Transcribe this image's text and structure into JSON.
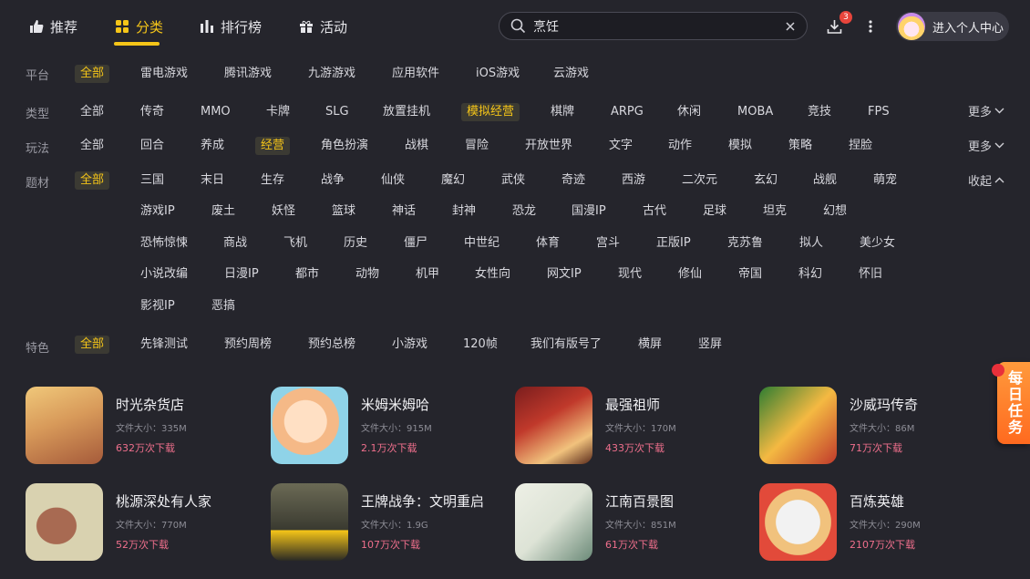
{
  "nav": {
    "tabs": [
      {
        "label": "推荐",
        "icon": "thumbs-up-icon"
      },
      {
        "label": "分类",
        "icon": "grid-icon"
      },
      {
        "label": "排行榜",
        "icon": "bar-chart-icon"
      },
      {
        "label": "活动",
        "icon": "gift-icon"
      }
    ],
    "active_index": 1,
    "accent": "#f5c518"
  },
  "search": {
    "value": "烹饪",
    "placeholder": ""
  },
  "downloads": {
    "badge": "3"
  },
  "profile": {
    "label": "进入个人中心"
  },
  "filters": {
    "platform": {
      "label": "平台",
      "options": [
        "全部",
        "雷电游戏",
        "腾讯游戏",
        "九游游戏",
        "应用软件",
        "iOS游戏",
        "云游戏"
      ],
      "selected": "全部"
    },
    "type": {
      "label": "类型",
      "options": [
        "全部",
        "传奇",
        "MMO",
        "卡牌",
        "SLG",
        "放置挂机",
        "模拟经营",
        "棋牌",
        "ARPG",
        "休闲",
        "MOBA",
        "竞技",
        "FPS"
      ],
      "selected": "模拟经营",
      "toggle": "更多"
    },
    "gameplay": {
      "label": "玩法",
      "options": [
        "全部",
        "回合",
        "养成",
        "经营",
        "角色扮演",
        "战棋",
        "冒险",
        "开放世界",
        "文字",
        "动作",
        "模拟",
        "策略",
        "捏脸"
      ],
      "selected": "经营",
      "toggle": "更多"
    },
    "theme": {
      "label": "题材",
      "selected": "全部",
      "toggle": "收起",
      "rows": [
        [
          "全部",
          "三国",
          "末日",
          "生存",
          "战争",
          "仙侠",
          "魔幻",
          "武侠",
          "奇迹",
          "西游",
          "二次元",
          "玄幻",
          "战舰",
          "萌宠"
        ],
        [
          "游戏IP",
          "废土",
          "妖怪",
          "篮球",
          "神话",
          "封神",
          "恐龙",
          "国漫IP",
          "古代",
          "足球",
          "坦克",
          "幻想"
        ],
        [
          "恐怖惊悚",
          "商战",
          "飞机",
          "历史",
          "僵尸",
          "中世纪",
          "体育",
          "宫斗",
          "正版IP",
          "克苏鲁",
          "拟人",
          "美少女"
        ],
        [
          "小说改编",
          "日漫IP",
          "都市",
          "动物",
          "机甲",
          "女性向",
          "网文IP",
          "现代",
          "修仙",
          "帝国",
          "科幻",
          "怀旧"
        ],
        [
          "影视IP",
          "恶搞"
        ]
      ]
    },
    "feature": {
      "label": "特色",
      "options": [
        "全部",
        "先锋测试",
        "预约周榜",
        "预约总榜",
        "小游戏",
        "120帧",
        "我们有版号了",
        "横屏",
        "竖屏"
      ],
      "selected": "全部"
    }
  },
  "games": [
    {
      "name": "时光杂货店",
      "size": "文件大小：335M",
      "downloads": "632万次下载",
      "colors": [
        "#f0c87a",
        "#a55a3a"
      ]
    },
    {
      "name": "米姆米姆哈",
      "size": "文件大小：915M",
      "downloads": "2.1万次下载",
      "colors": [
        "#ffd1a8",
        "#8fd3e8"
      ]
    },
    {
      "name": "最强祖师",
      "size": "文件大小：170M",
      "downloads": "433万次下载",
      "colors": [
        "#c0392b",
        "#f1c27d"
      ]
    },
    {
      "name": "沙威玛传奇",
      "size": "文件大小：86M",
      "downloads": "71万次下载",
      "colors": [
        "#2e7d32",
        "#f4b942"
      ]
    },
    {
      "name": "桃源深处有人家",
      "size": "文件大小：770M",
      "downloads": "52万次下载",
      "colors": [
        "#d9d2b0",
        "#a86a52"
      ]
    },
    {
      "name": "王牌战争：文明重启",
      "size": "文件大小：1.9G",
      "downloads": "107万次下载",
      "colors": [
        "#4a4a3a",
        "#f5c518"
      ]
    },
    {
      "name": "江南百景图",
      "size": "文件大小：851M",
      "downloads": "61万次下载",
      "colors": [
        "#dde3d6",
        "#6b8a78"
      ]
    },
    {
      "name": "百炼英雄",
      "size": "文件大小：290M",
      "downloads": "2107万次下载",
      "colors": [
        "#f2f2f2",
        "#e24a3a"
      ]
    }
  ],
  "daily_task": {
    "label": "每日任务"
  }
}
